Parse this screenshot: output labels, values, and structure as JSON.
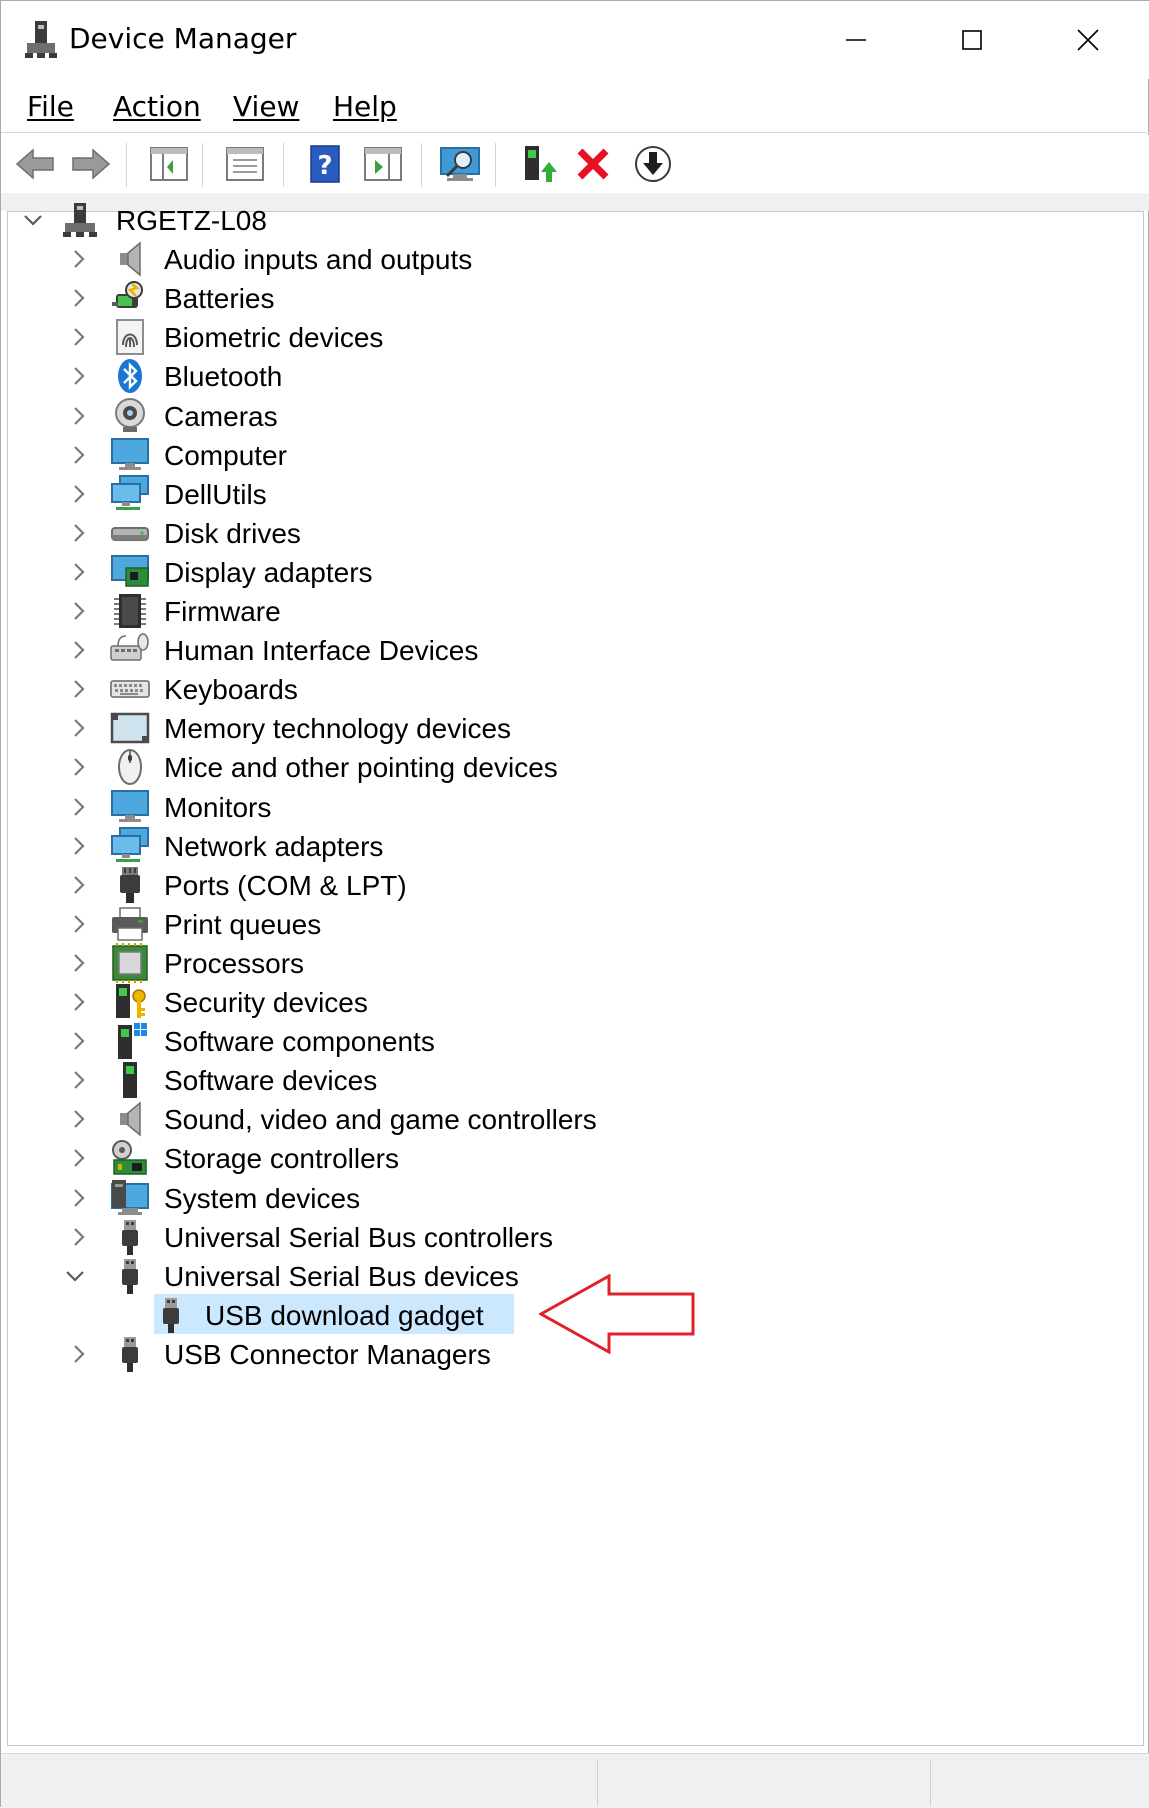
{
  "window": {
    "title": "Device Manager"
  },
  "menu": {
    "file": "File",
    "action": "Action",
    "view": "View",
    "help": "Help"
  },
  "toolbar": {
    "buttons": [
      "back-icon",
      "forward-icon",
      "show-hide-console-tree-icon",
      "properties-icon",
      "help-icon",
      "run-action-icon",
      "scan-hardware-icon",
      "update-driver-icon",
      "uninstall-icon",
      "enable-device-icon"
    ]
  },
  "tree": {
    "root": "RGETZ-L08",
    "categories": [
      {
        "label": "Audio inputs and outputs",
        "icon": "speaker-icon"
      },
      {
        "label": "Batteries",
        "icon": "battery-icon"
      },
      {
        "label": "Biometric devices",
        "icon": "fingerprint-icon"
      },
      {
        "label": "Bluetooth",
        "icon": "bluetooth-icon"
      },
      {
        "label": "Cameras",
        "icon": "webcam-icon"
      },
      {
        "label": "Computer",
        "icon": "computer-icon"
      },
      {
        "label": "DellUtils",
        "icon": "network-computer-icon"
      },
      {
        "label": "Disk drives",
        "icon": "disk-drive-icon"
      },
      {
        "label": "Display adapters",
        "icon": "display-adapter-icon"
      },
      {
        "label": "Firmware",
        "icon": "chip-icon"
      },
      {
        "label": "Human Interface Devices",
        "icon": "hid-icon"
      },
      {
        "label": "Keyboards",
        "icon": "keyboard-icon"
      },
      {
        "label": "Memory technology devices",
        "icon": "memory-card-icon"
      },
      {
        "label": "Mice and other pointing devices",
        "icon": "mouse-icon"
      },
      {
        "label": "Monitors",
        "icon": "monitor-icon"
      },
      {
        "label": "Network adapters",
        "icon": "network-adapter-icon"
      },
      {
        "label": "Ports (COM & LPT)",
        "icon": "port-icon"
      },
      {
        "label": "Print queues",
        "icon": "printer-icon"
      },
      {
        "label": "Processors",
        "icon": "processor-icon"
      },
      {
        "label": "Security devices",
        "icon": "security-key-icon"
      },
      {
        "label": "Software components",
        "icon": "software-component-icon"
      },
      {
        "label": "Software devices",
        "icon": "software-device-icon"
      },
      {
        "label": "Sound, video and game controllers",
        "icon": "speaker-icon"
      },
      {
        "label": "Storage controllers",
        "icon": "storage-controller-icon"
      },
      {
        "label": "System devices",
        "icon": "system-device-icon"
      },
      {
        "label": "Universal Serial Bus controllers",
        "icon": "usb-icon"
      },
      {
        "label": "Universal Serial Bus devices",
        "icon": "usb-icon",
        "expanded": true
      },
      {
        "label": "USB download gadget",
        "icon": "usb-icon",
        "child": true,
        "selected": true
      },
      {
        "label": "USB Connector Managers",
        "icon": "usb-icon"
      }
    ]
  },
  "colors": {
    "selection": "#cce8ff",
    "annotation_arrow": "#e0202a",
    "uninstall_x": "#e81123",
    "help_blue": "#2a5cbf"
  }
}
